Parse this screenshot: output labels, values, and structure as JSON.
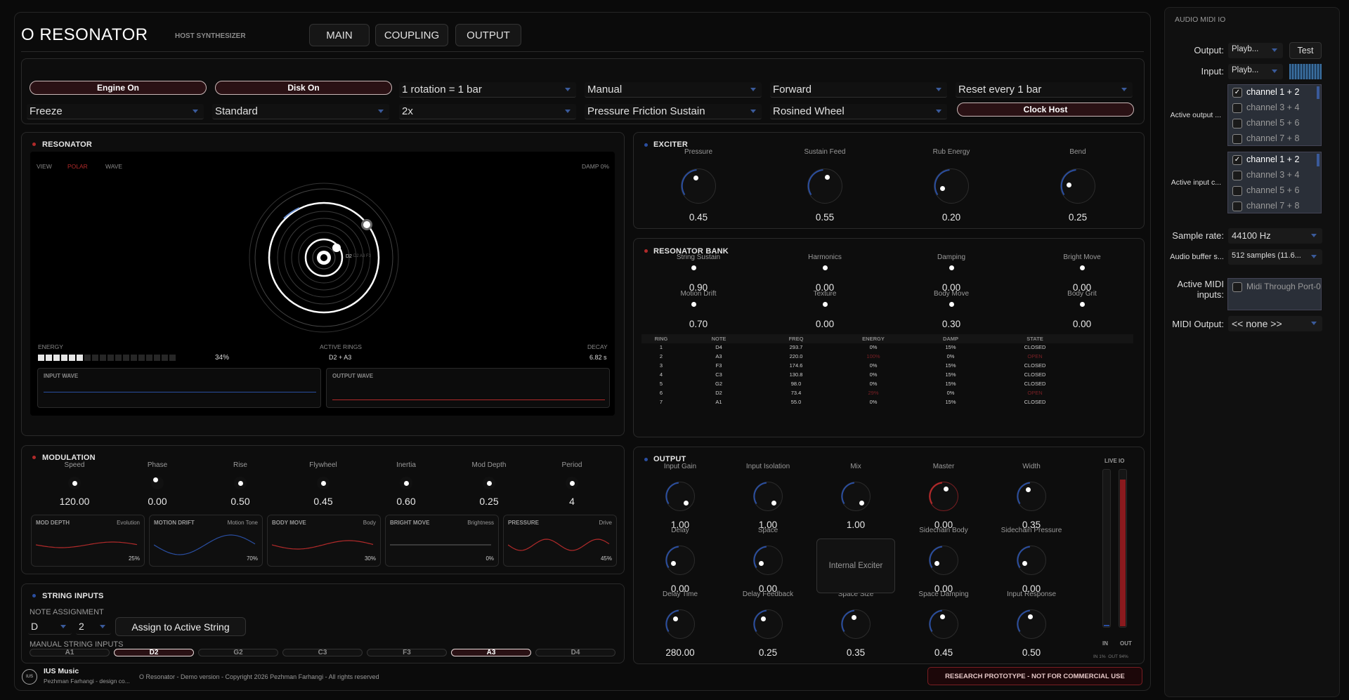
{
  "header": {
    "title": "O RESONATOR",
    "subtitle": "HOST SYNTHESIZER",
    "tabs": [
      "MAIN",
      "COUPLING",
      "OUTPUT"
    ]
  },
  "controls": {
    "engine_on": "Engine On",
    "disk_on": "Disk On",
    "rotation": "1 rotation = 1 bar",
    "mode": "Manual",
    "direction": "Forward",
    "reset": "Reset every 1 bar",
    "freeze": "Freeze",
    "standard": "Standard",
    "mult": "2x",
    "exciter_model": "Pressure Friction Sustain",
    "wheel": "Rosined Wheel",
    "clock_host": "Clock Host"
  },
  "resonator": {
    "title": "RESONATOR",
    "view_label": "VIEW",
    "view_polar": "POLAR",
    "view_wave": "WAVE",
    "damp": "DAMP 0%",
    "ring_note_labels": "D2",
    "ring_note_sub": "D2 A3 F3",
    "energy_label": "ENERGY",
    "energy_value": "34%",
    "energy_fraction": 0.34,
    "active_rings_label": "ACTIVE RINGS",
    "active_rings_value": "D2 + A3",
    "decay_label": "DECAY",
    "decay_value": "6.82 s",
    "input_wave": "INPUT WAVE",
    "output_wave": "OUTPUT WAVE"
  },
  "exciter": {
    "title": "EXCITER",
    "knobs": [
      {
        "label": "Pressure",
        "value": "0.45"
      },
      {
        "label": "Sustain Feed",
        "value": "0.55"
      },
      {
        "label": "Rub Energy",
        "value": "0.20"
      },
      {
        "label": "Bend",
        "value": "0.25"
      }
    ]
  },
  "bank": {
    "title": "RESONATOR BANK",
    "knobs": [
      {
        "label": "String Sustain",
        "value": "0.90"
      },
      {
        "label": "Harmonics",
        "value": "0.00"
      },
      {
        "label": "Damping",
        "value": "0.00"
      },
      {
        "label": "Bright Move",
        "value": "0.00"
      },
      {
        "label": "Motion Drift",
        "value": "0.70"
      },
      {
        "label": "Texture",
        "value": "0.00"
      },
      {
        "label": "Body Move",
        "value": "0.30"
      },
      {
        "label": "Body Grit",
        "value": "0.00"
      }
    ],
    "columns": [
      "RING",
      "NOTE",
      "FREQ",
      "ENERGY",
      "DAMP",
      "STATE"
    ],
    "rows": [
      [
        "1",
        "D4",
        "293.7",
        "0%",
        "15%",
        "CLOSED"
      ],
      [
        "2",
        "A3",
        "220.0",
        "100%",
        "0%",
        "OPEN"
      ],
      [
        "3",
        "F3",
        "174.6",
        "0%",
        "15%",
        "CLOSED"
      ],
      [
        "4",
        "C3",
        "130.8",
        "0%",
        "15%",
        "CLOSED"
      ],
      [
        "5",
        "G2",
        "98.0",
        "0%",
        "15%",
        "CLOSED"
      ],
      [
        "6",
        "D2",
        "73.4",
        "29%",
        "0%",
        "OPEN"
      ],
      [
        "7",
        "A1",
        "55.0",
        "0%",
        "15%",
        "CLOSED"
      ]
    ]
  },
  "modulation": {
    "title": "MODULATION",
    "knobs": [
      {
        "label": "Speed",
        "value": "120.00"
      },
      {
        "label": "Phase",
        "value": "0.00"
      },
      {
        "label": "Rise",
        "value": "0.50"
      },
      {
        "label": "Flywheel",
        "value": "0.45"
      },
      {
        "label": "Inertia",
        "value": "0.60"
      },
      {
        "label": "Mod Depth",
        "value": "0.25"
      },
      {
        "label": "Period",
        "value": "4"
      }
    ],
    "cards": [
      {
        "name": "MOD DEPTH",
        "target": "Evolution",
        "pct": "25%",
        "color": "#b02a2a"
      },
      {
        "name": "MOTION DRIFT",
        "target": "Motion Tone",
        "pct": "70%",
        "color": "#2a4ea0"
      },
      {
        "name": "BODY MOVE",
        "target": "Body",
        "pct": "30%",
        "color": "#b02a2a"
      },
      {
        "name": "BRIGHT MOVE",
        "target": "Brightness",
        "pct": "0%",
        "color": "#555555"
      },
      {
        "name": "PRESSURE",
        "target": "Drive",
        "pct": "45%",
        "color": "#b02a2a"
      }
    ]
  },
  "strings": {
    "title": "STRING INPUTS",
    "note_assignment": "NOTE ASSIGNMENT",
    "note": "D",
    "octave": "2",
    "assign_button": "Assign to Active String",
    "manual_label": "MANUAL STRING INPUTS",
    "buttons": [
      "A1",
      "D2",
      "G2",
      "C3",
      "F3",
      "A3",
      "D4"
    ]
  },
  "output": {
    "title": "OUTPUT",
    "knobs_row1": [
      {
        "label": "Input Gain",
        "value": "1.00"
      },
      {
        "label": "Input Isolation",
        "value": "1.00"
      },
      {
        "label": "Mix",
        "value": "1.00"
      },
      {
        "label": "Master",
        "value": "0.00"
      },
      {
        "label": "Width",
        "value": "0.35"
      }
    ],
    "knobs_row2": [
      {
        "label": "Delay",
        "value": "0.00"
      },
      {
        "label": "Space",
        "value": "0.00"
      },
      {
        "label": "Sidechain Body",
        "value": "0.00"
      },
      {
        "label": "Sidechain Pressure",
        "value": "0.00"
      }
    ],
    "internal_exciter": "Internal Exciter",
    "knobs_row3": [
      {
        "label": "Delay Time",
        "value": "280.00"
      },
      {
        "label": "Delay Feedback",
        "value": "0.25"
      },
      {
        "label": "Space Size",
        "value": "0.35"
      },
      {
        "label": "Space Damping",
        "value": "0.45"
      },
      {
        "label": "Input Response",
        "value": "0.50"
      }
    ],
    "live_io": "LIVE IO",
    "in_label": "IN",
    "out_label": "OUT",
    "meter_text": "IN 1%  OUT 94%",
    "in_level": 0.01,
    "out_level": 0.94
  },
  "footer": {
    "logo": "IUS",
    "brand": "IUS Music",
    "author": "Pezhman Farhangi - design co...",
    "copyright": "O Resonator - Demo version - Copyright 2026 Pezhman Farhangi - All rights reserved",
    "notice": "RESEARCH PROTOTYPE - NOT FOR COMMERCIAL USE"
  },
  "audio_io": {
    "title": "AUDIO MIDI IO",
    "output_label": "Output:",
    "output_value": "Playb...",
    "test_button": "Test",
    "input_label": "Input:",
    "input_value": "Playb...",
    "active_output_label": "Active output ...",
    "active_input_label": "Active input c...",
    "channels": [
      "channel 1 + 2",
      "channel 3 + 4",
      "channel 5 + 6",
      "channel 7 + 8"
    ],
    "check_mark": "✓",
    "sample_rate_label": "Sample rate:",
    "sample_rate_value": "44100 Hz",
    "buffer_label": "Audio buffer s...",
    "buffer_value": "512 samples (11.6...",
    "midi_inputs_label": "Active MIDI inputs:",
    "midi_inputs_value": "Midi Through Port-0",
    "midi_output_label": "MIDI Output:",
    "midi_output_value": "<< none >>"
  },
  "colors": {
    "accent_red": "#b02a2a",
    "accent_blue": "#2a4ea0",
    "pill_bg": "#2a1114"
  }
}
